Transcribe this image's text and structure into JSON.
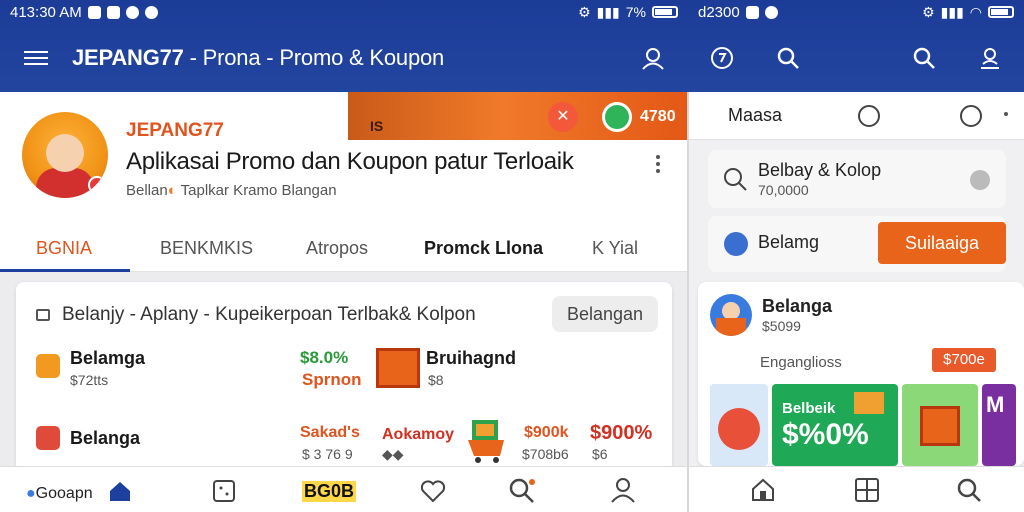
{
  "left": {
    "status": {
      "time": "413:30 AM",
      "percent": "7%"
    },
    "appbar": {
      "title_bold": "JEPANG77",
      "title_rest": " - Prona - Promo & Koupon"
    },
    "banner": {
      "label": "IS",
      "count": "4780"
    },
    "profile": {
      "brand": "JEPANG77",
      "headline": "Aplikasai Promo dan Koupon patur Terloaik",
      "sub_prefix": "Bellan",
      "sub_rest": " Taplkar Kramo Blangan"
    },
    "tabs": [
      "BGNIA",
      "BENKMKIS",
      "Atropos",
      "Promck Llona",
      "K Yial"
    ],
    "list": {
      "title": "Belanjy - Aplany - Kupeikerpoan Terlbak& Kolpon",
      "button": "Belangan",
      "rows": [
        {
          "name": "Belamga",
          "sub": "$72tts",
          "pct": "$8.0%",
          "pct2": "Sprnon",
          "shop": "Bruihagnd",
          "shop_sub": "$8"
        },
        {
          "name": "Belanga",
          "sub": "",
          "a": "Sakad's",
          "a_sub": "$ 3 76 9",
          "b": "Aokamoy",
          "c": "$900k",
          "c_sub": "$708b6",
          "d": "$900%",
          "d_sub": "$6"
        }
      ]
    },
    "bottom": {
      "brand": "Gooapn",
      "mid": "BG0B"
    }
  },
  "right": {
    "status": {
      "time": "d2300"
    },
    "row1": {
      "label": "Maasa"
    },
    "search_card": {
      "title": "Belbay & Kolop",
      "sub": "70,0000"
    },
    "nav_card": {
      "label": "Belamg",
      "button": "Suilaaiga"
    },
    "product": {
      "name": "Belanga",
      "price": "$5099",
      "tag": "Enganglioss",
      "badge": "$700e"
    },
    "tile": {
      "line1": "Belbeik",
      "line2": "$%0%"
    }
  },
  "colors": {
    "brand_blue": "#1d3f9e",
    "accent_orange": "#e8641a",
    "green": "#2a9a3a"
  }
}
